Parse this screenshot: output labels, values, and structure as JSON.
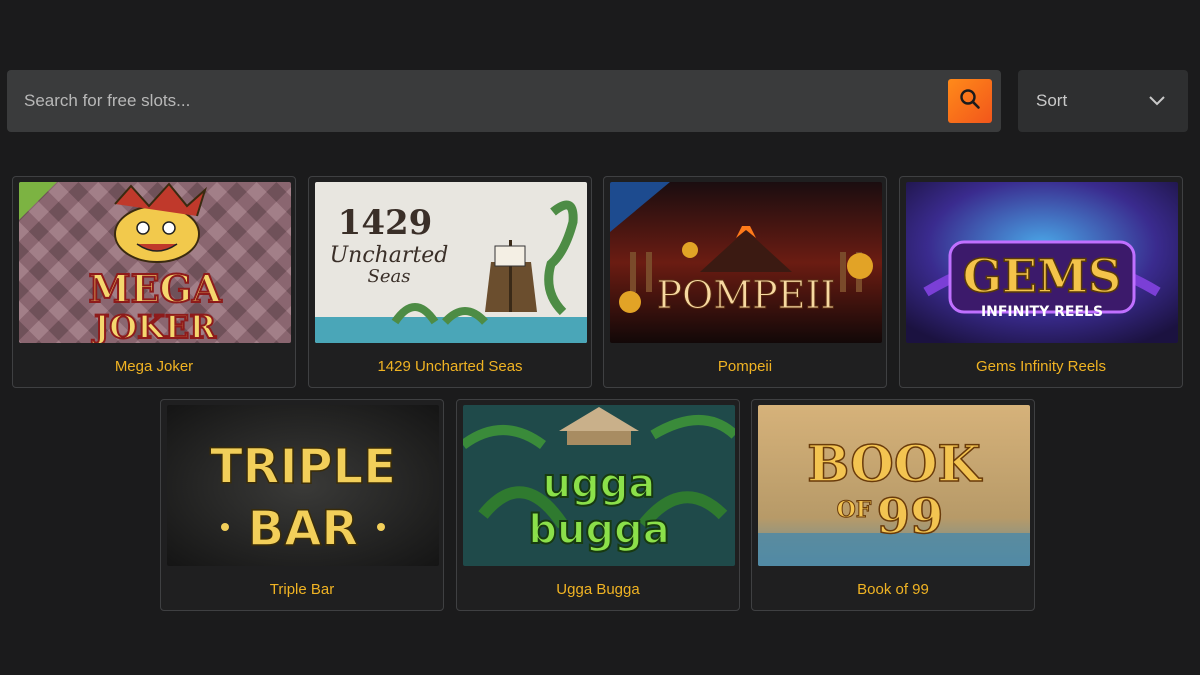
{
  "search": {
    "placeholder": "Search for free slots..."
  },
  "sort": {
    "label": "Sort"
  },
  "games": [
    {
      "title": "Mega Joker",
      "art_text": [
        "MEGA",
        "JOKER"
      ]
    },
    {
      "title": "1429 Uncharted Seas",
      "art_text": [
        "1429",
        "Uncharted",
        "Seas"
      ]
    },
    {
      "title": "Pompeii",
      "art_text": [
        "POMPEII"
      ]
    },
    {
      "title": "Gems Infinity Reels",
      "art_text": [
        "GEMS",
        "INFINITY REELS"
      ]
    },
    {
      "title": "Triple Bar",
      "art_text": [
        "TRIPLE",
        "BAR"
      ]
    },
    {
      "title": "Ugga Bugga",
      "art_text": [
        "ugga",
        "bugga"
      ]
    },
    {
      "title": "Book of 99",
      "art_text": [
        "BOOK",
        "OF",
        "99"
      ]
    }
  ],
  "colors": {
    "accent": "#f0b323",
    "search_button": "#f46a1b",
    "background": "#1b1b1c"
  }
}
